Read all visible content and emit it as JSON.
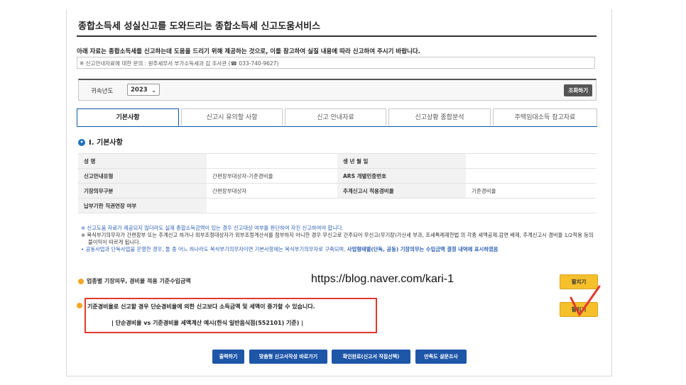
{
  "header": {
    "title": "종합소득세 성실신고를 도와드리는 종합소득세 신고도움서비스",
    "intro": "아래 자료는 종합소득세를 신고하는데 도움을 드리기 위해 제공하는 것으로, 이를 참고하여 실질 내용에 따라 신고하여 주시기 바랍니다.",
    "contact": "※ 신고안내자료에 대한 문의 : 원주세무서 부가소득세과 김      조사관 (☎ 033-740-9627)"
  },
  "year_bar": {
    "label": "귀속년도",
    "selected": "2023",
    "search_button": "조회하기"
  },
  "tabs": [
    {
      "label": "기본사항"
    },
    {
      "label": "신고시 유의할 사항"
    },
    {
      "label": "신고 안내자료"
    },
    {
      "label": "신고상황 종합분석"
    },
    {
      "label": "주택임대소득 참고자료"
    }
  ],
  "section": {
    "number": "1",
    "title": "Ⅰ. 기본사항"
  },
  "info_table": [
    [
      "성          명",
      "",
      "생 년 월 일",
      ""
    ],
    [
      "신고안내유형",
      "간편장부대상자-기준경비율",
      "ARS 개별인증번호",
      ""
    ],
    [
      "기장의무구분",
      "간편장부대상자",
      "추계신고시 적용경비율",
      "기준경비율"
    ],
    [
      "납부기한 직권연장 여부",
      "",
      "",
      ""
    ]
  ],
  "notes": {
    "n1": "※  신고도움 자료가 제공되지 않더라도 실제 종합소득금액이 있는 경우 신고대상 여부를 판단하여 자진 신고하여야 합니다.",
    "n2": "※  복식부기의무자가 간편장부 또는 추계신고 하거나 외부조정대상자가 외부조정계산서를 첨부하지 아니한 경우 무신고로 간주되어 무신고(무기장)가산세 부과, 조세특례제한법 의 각종 세액공제.감면 배제, 추계신고시 경비율 1/2적용 등의 불이익이 따르게 됩니다.",
    "n3a": "•  공동사업과 단독사업을 운영한 경우, 둘 중 어느 하나라도 복식부기의무자이면 기본사항에는 복식부기의무자로 구축되며, ",
    "n3b": "사업형태별(단독, 공동) 기장의무는 수입금액 결정 내역에 표시하였음"
  },
  "row1": {
    "label": "업종별 기장의무, 경비율 적용 기준수입금액",
    "button": "펼치기"
  },
  "watermark": "https://blog.naver.com/kari-1",
  "row2": {
    "label": "기준경비율로 신고할 경우 단순경비율에 의한 신고보다 소득금액 및 세액이 증가할 수 있습니다.",
    "sub": "| 단순경비율 vs 기준경비율 세액계산 예시(한식 일반음식점(552101) 기준) |",
    "button": "펼치기"
  },
  "bottom_buttons": [
    {
      "label": "출력하기"
    },
    {
      "label": "맞춤형 신고서작성 바로가기"
    },
    {
      "label": "확인완료(신고서 직접선택)"
    },
    {
      "label": "만족도 설문조사"
    }
  ],
  "colors": {
    "accent_blue": "#1e56a8",
    "highlight_red": "#e03a2e",
    "button_yellow": "#f6c02b"
  }
}
